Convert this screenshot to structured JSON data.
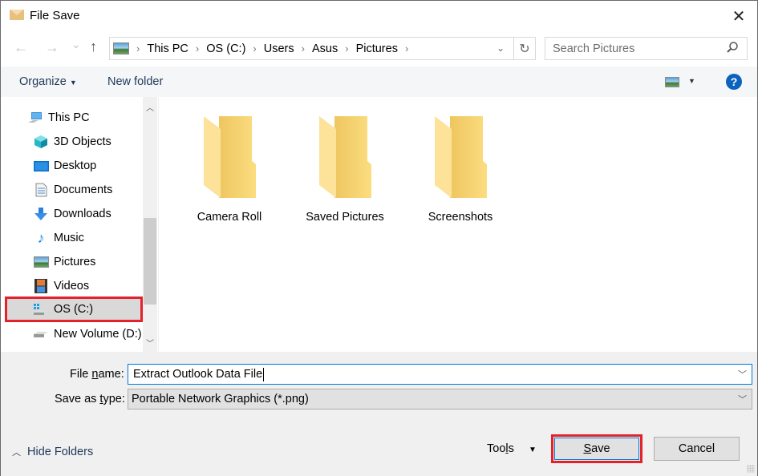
{
  "window": {
    "title": "File Save",
    "close_label": "✕"
  },
  "nav": {
    "back_icon": "←",
    "forward_icon": "→",
    "recent_icon": "⌄",
    "up_icon": "↑",
    "breadcrumb": [
      "This PC",
      "OS (C:)",
      "Users",
      "Asus",
      "Pictures"
    ],
    "separator": "›",
    "refresh_icon": "↻",
    "dropdown_icon": "⌄"
  },
  "search": {
    "placeholder": "Search Pictures",
    "icon": "⚲"
  },
  "toolbar": {
    "organize_label": "Organize",
    "new_folder_label": "New folder",
    "help_label": "?"
  },
  "sidebar": {
    "items": [
      {
        "label": "This PC",
        "icon": "this-pc",
        "indent": 0
      },
      {
        "label": "3D Objects",
        "icon": "3d-objects",
        "indent": 1
      },
      {
        "label": "Desktop",
        "icon": "desktop",
        "indent": 1
      },
      {
        "label": "Documents",
        "icon": "documents",
        "indent": 1
      },
      {
        "label": "Downloads",
        "icon": "downloads",
        "indent": 1
      },
      {
        "label": "Music",
        "icon": "music",
        "indent": 1
      },
      {
        "label": "Pictures",
        "icon": "pictures",
        "indent": 1
      },
      {
        "label": "Videos",
        "icon": "videos",
        "indent": 1
      },
      {
        "label": "OS (C:)",
        "icon": "drive-c",
        "indent": 1,
        "selected": true
      },
      {
        "label": "New Volume (D:)",
        "icon": "drive-d",
        "indent": 1
      }
    ]
  },
  "folders": [
    {
      "label": "Camera Roll"
    },
    {
      "label": "Saved Pictures"
    },
    {
      "label": "Screenshots"
    }
  ],
  "form": {
    "file_name_label_pre": "File ",
    "file_name_label_u": "n",
    "file_name_label_post": "ame:",
    "file_name_value": "Extract Outlook Data File",
    "save_type_label_pre": "Save as ",
    "save_type_label_u": "t",
    "save_type_label_post": "ype:",
    "save_type_value": "Portable Network Graphics (*.png)"
  },
  "footer": {
    "hide_folders_label": "Hide Folders",
    "tools_pre": "Too",
    "tools_u": "l",
    "tools_post": "s",
    "save_u": "S",
    "save_post": "ave",
    "cancel_label": "Cancel"
  },
  "colors": {
    "highlight": "#e3222b",
    "accent": "#0078d7",
    "help": "#0c63bd"
  }
}
